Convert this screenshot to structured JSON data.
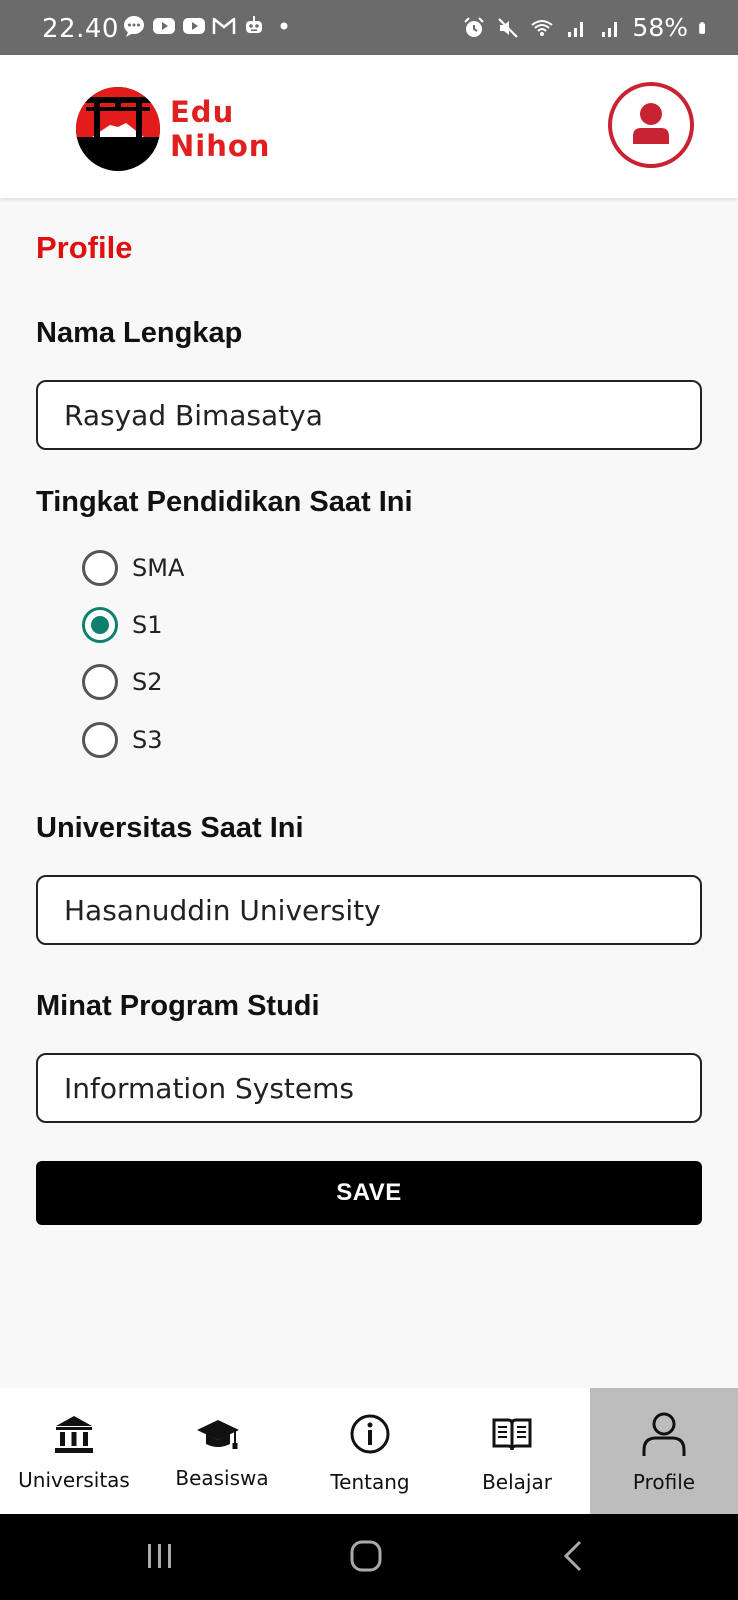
{
  "status_bar": {
    "time": "22.40",
    "battery": "58%",
    "left_icons": [
      "chat-bubble-icon",
      "youtube-icon",
      "youtube-icon",
      "gmail-icon",
      "robot-icon",
      "dot-icon"
    ],
    "right_icons": [
      "alarm-icon",
      "mute-icon",
      "wifi-icon",
      "signal-icon",
      "signal-icon",
      "battery-icon"
    ]
  },
  "header": {
    "brand_line1": "Edu",
    "brand_line2": "Nihon",
    "logo_icon": "torii-gate-logo",
    "profile_icon": "user-icon",
    "brand_color": "#e02020"
  },
  "page": {
    "title": "Profile",
    "accent_color": "#e01010"
  },
  "form": {
    "name_label": "Nama Lengkap",
    "name_value": "Rasyad Bimasatya",
    "education_label": "Tingkat Pendidikan Saat Ini",
    "education_options": [
      {
        "label": "SMA",
        "checked": false
      },
      {
        "label": "S1",
        "checked": true
      },
      {
        "label": "S2",
        "checked": false
      },
      {
        "label": "S3",
        "checked": false
      }
    ],
    "university_label": "Universitas Saat Ini",
    "university_value": "Hasanuddin University",
    "program_label": "Minat Program Studi",
    "program_value": "Information Systems",
    "save_label": "SAVE",
    "radio_color": "#0f7f6e"
  },
  "bottom_nav": {
    "items": [
      {
        "label": "Universitas",
        "icon": "institution-icon",
        "active": false
      },
      {
        "label": "Beasiswa",
        "icon": "graduation-cap-icon",
        "active": false
      },
      {
        "label": "Tentang",
        "icon": "info-icon",
        "active": false
      },
      {
        "label": "Belajar",
        "icon": "book-icon",
        "active": false
      },
      {
        "label": "Profile",
        "icon": "person-icon",
        "active": true
      }
    ]
  },
  "system_nav": {
    "icons": [
      "recent-apps-icon",
      "home-icon",
      "back-icon"
    ]
  }
}
